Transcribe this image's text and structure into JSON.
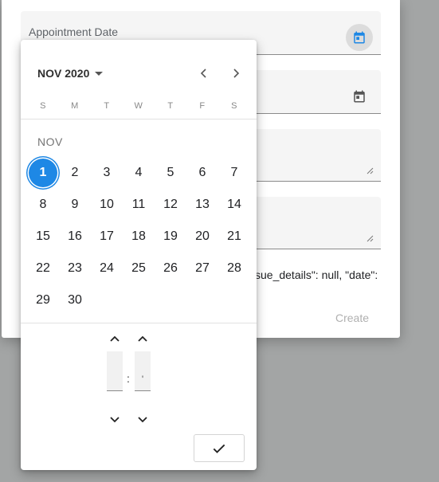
{
  "form": {
    "appointment_label": "Appointment Date",
    "json_snippet": "sue_details\": null, \"date\":",
    "create_label": "Create"
  },
  "picker": {
    "month_year": "NOV 2020",
    "month_label": "NOV",
    "weekdays": [
      "S",
      "M",
      "T",
      "W",
      "T",
      "F",
      "S"
    ],
    "days": [
      "1",
      "2",
      "3",
      "4",
      "5",
      "6",
      "7",
      "8",
      "9",
      "10",
      "11",
      "12",
      "13",
      "14",
      "15",
      "16",
      "17",
      "18",
      "19",
      "20",
      "21",
      "22",
      "23",
      "24",
      "25",
      "26",
      "27",
      "28",
      "29",
      "30"
    ],
    "selected_day": "1",
    "hour_value": "",
    "minute_value": "'",
    "separator": ":"
  },
  "colors": {
    "accent": "#1e88e5",
    "backdrop": "#a3a5a5"
  },
  "icons": {
    "calendar": "calendar-icon",
    "prev": "chevron-left-icon",
    "next": "chevron-right-icon",
    "dropdown": "caret-down-icon",
    "confirm": "check-icon",
    "up": "chevron-up-icon",
    "down": "chevron-down-icon"
  }
}
